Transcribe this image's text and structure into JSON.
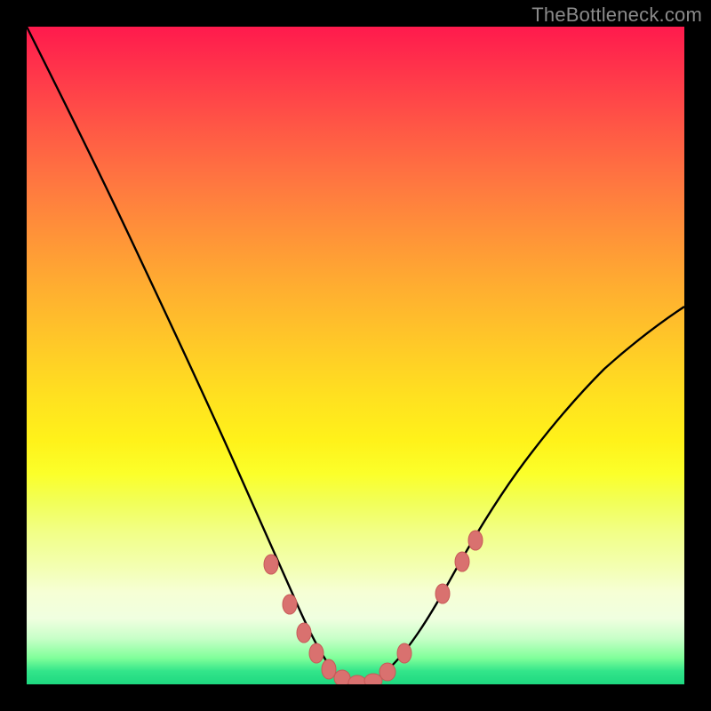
{
  "watermark": "TheBottleneck.com",
  "colors": {
    "frame": "#000000",
    "curve_stroke": "#000000",
    "marker_fill": "#d9716f",
    "marker_stroke": "#c75a58"
  },
  "chart_data": {
    "type": "line",
    "title": "",
    "xlabel": "",
    "ylabel": "",
    "xlim": [
      0,
      100
    ],
    "ylim": [
      0,
      100
    ],
    "grid": false,
    "legend": false,
    "x": [
      0,
      5,
      10,
      15,
      20,
      25,
      30,
      35,
      37,
      40,
      43,
      46,
      48,
      50,
      53,
      56,
      60,
      65,
      70,
      75,
      80,
      85,
      90,
      95,
      100
    ],
    "y": [
      100,
      88,
      76,
      64,
      53,
      42,
      32,
      22,
      18,
      12,
      7,
      3,
      1,
      0,
      1,
      4,
      9,
      17,
      25,
      33,
      40,
      46,
      51,
      55,
      58
    ],
    "series": [
      {
        "name": "bottleneck-curve",
        "x": [
          0,
          5,
          10,
          15,
          20,
          25,
          30,
          35,
          37,
          40,
          43,
          46,
          48,
          50,
          53,
          56,
          60,
          65,
          70,
          75,
          80,
          85,
          90,
          95,
          100
        ],
        "y": [
          100,
          88,
          76,
          64,
          53,
          42,
          32,
          22,
          18,
          12,
          7,
          3,
          1,
          0,
          1,
          4,
          9,
          17,
          25,
          33,
          40,
          46,
          51,
          55,
          58
        ]
      }
    ],
    "markers": [
      {
        "x": 37,
        "y": 18
      },
      {
        "x": 40,
        "y": 12
      },
      {
        "x": 42,
        "y": 8
      },
      {
        "x": 44,
        "y": 5
      },
      {
        "x": 46,
        "y": 2
      },
      {
        "x": 48,
        "y": 1
      },
      {
        "x": 50,
        "y": 0
      },
      {
        "x": 52,
        "y": 1
      },
      {
        "x": 54,
        "y": 2
      },
      {
        "x": 57,
        "y": 5
      },
      {
        "x": 63,
        "y": 14
      },
      {
        "x": 66,
        "y": 19
      },
      {
        "x": 68,
        "y": 22
      }
    ]
  }
}
